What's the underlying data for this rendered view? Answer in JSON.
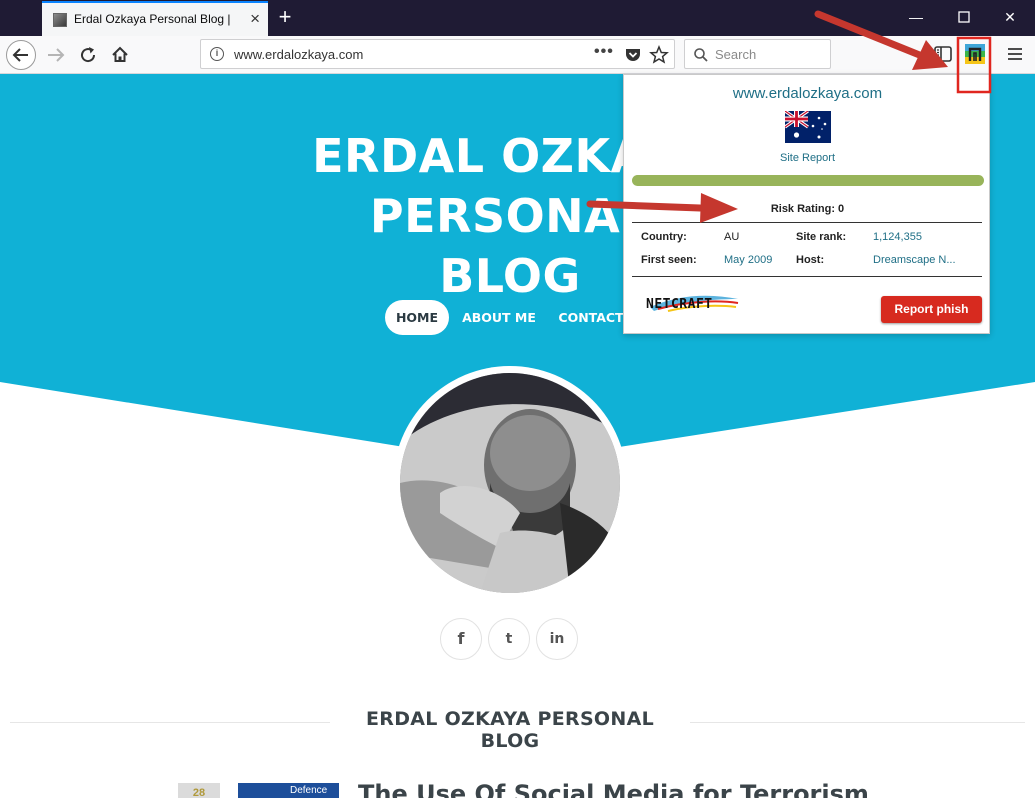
{
  "browser": {
    "tab_title": "Erdal Ozkaya Personal Blog |",
    "tab_close": "×",
    "new_tab": "+",
    "url": "www.erdalozkaya.com",
    "url_actions": "•••",
    "search_placeholder": "Search",
    "minimize": "—",
    "close": "✕"
  },
  "site": {
    "title_line1": "ERDAL OZKAYA PERSONAL",
    "title_line2": "BLOG",
    "menu": [
      "HOME",
      "ABOUT ME",
      "CONTACT"
    ],
    "social": [
      "f",
      "t",
      "in"
    ],
    "blog_heading": "ERDAL OZKAYA PERSONAL BLOG",
    "post_date": "28",
    "post_thumb_text": "Defence",
    "post_title": "The Use Of Social Media for Terrorism"
  },
  "netcraft": {
    "domain": "www.erdalozkaya.com",
    "site_report": "Site Report",
    "risk_rating": "Risk Rating: 0",
    "country_label": "Country:",
    "country_value": "AU",
    "site_rank_label": "Site rank:",
    "site_rank_value": "1,124,355",
    "first_seen_label": "First seen:",
    "first_seen_value": "May 2009",
    "host_label": "Host:",
    "host_value": "Dreamscape N...",
    "logo_text": "NETCRAFT",
    "report_phish": "Report phish"
  },
  "colors": {
    "hero": "#10b1d6",
    "annotation_red": "#e0261f",
    "netcraft_link": "#1f6f86",
    "risk_bar": "#98b45a"
  }
}
